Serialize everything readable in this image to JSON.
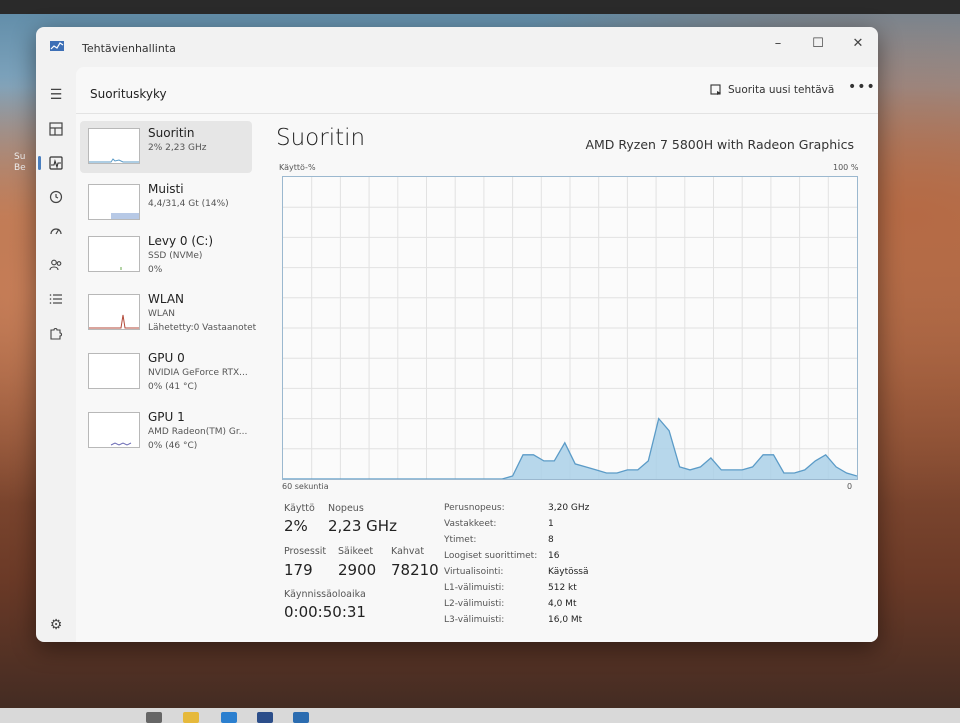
{
  "window": {
    "title": "Tehtävienhallinta"
  },
  "header": {
    "title": "Suorituskyky",
    "run_task": "Suorita uusi tehtävä",
    "more": "•••"
  },
  "desktop": {
    "label1": "Su",
    "label2": "Su",
    "label3": "Be"
  },
  "devices": [
    {
      "name": "Suoritin",
      "sub1": "2%  2,23 GHz",
      "sub2": "",
      "sub3": ""
    },
    {
      "name": "Muisti",
      "sub1": "4,4/31,4 Gt (14%)",
      "sub2": "",
      "sub3": ""
    },
    {
      "name": "Levy 0 (C:)",
      "sub1": "SSD (NVMe)",
      "sub2": "0%",
      "sub3": ""
    },
    {
      "name": "WLAN",
      "sub1": "WLAN",
      "sub2": "Lähetetty:0 Vastaanotet",
      "sub3": ""
    },
    {
      "name": "GPU 0",
      "sub1": "NVIDIA GeForce RTX...",
      "sub2": "0%  (41 °C)",
      "sub3": ""
    },
    {
      "name": "GPU 1",
      "sub1": "AMD Radeon(TM) Gr...",
      "sub2": "0%  (46 °C)",
      "sub3": ""
    }
  ],
  "cpu": {
    "title": "Suoritin",
    "model": "AMD Ryzen 7 5800H with Radeon Graphics",
    "graph_label": "Käyttö-%",
    "graph_max": "100 %",
    "time_span": "60 sekuntia",
    "time_end": "0"
  },
  "chart_data": {
    "type": "area",
    "title": "",
    "xlabel": "60 sekuntia",
    "ylabel": "Käyttö-%",
    "ylim": [
      0,
      100
    ],
    "x": [
      60,
      58,
      57,
      55,
      54,
      53,
      52,
      51,
      50,
      49,
      48,
      47,
      45,
      43,
      42,
      41,
      40,
      39,
      38,
      36,
      35,
      34,
      33,
      32,
      31,
      30,
      29,
      28,
      27,
      26,
      25,
      24,
      23,
      22,
      21,
      20,
      19,
      18,
      17,
      16,
      15,
      14,
      13,
      12,
      11,
      10,
      9,
      8,
      7,
      6,
      5,
      4,
      3,
      2,
      1,
      0
    ],
    "values": [
      0,
      0,
      0,
      0,
      0,
      0,
      0,
      0,
      0,
      0,
      0,
      0,
      0,
      0,
      0,
      0,
      0,
      0,
      0,
      0,
      0,
      0,
      0,
      0,
      0,
      0,
      0,
      0,
      0,
      0,
      0,
      0,
      0,
      0,
      0,
      0,
      0,
      0,
      0,
      0,
      0,
      0,
      0,
      0,
      0,
      0,
      0,
      0,
      0,
      0,
      0,
      0,
      0,
      0,
      0,
      0
    ],
    "series": [
      {
        "values": [
          0,
          0,
          0,
          0,
          0,
          0,
          0,
          0,
          0,
          0,
          0,
          0,
          0,
          0,
          0,
          0,
          0,
          0,
          0,
          0,
          0,
          0,
          1,
          8,
          8,
          6,
          6,
          12,
          5,
          4,
          3,
          2,
          2,
          3,
          3,
          6,
          20,
          16,
          4,
          3,
          4,
          7,
          3,
          3,
          3,
          4,
          8,
          8,
          2,
          2,
          3,
          6,
          8,
          4,
          2,
          1
        ]
      }
    ]
  },
  "stats": {
    "usage_label": "Käyttö",
    "usage_value": "2%",
    "speed_label": "Nopeus",
    "speed_value": "2,23 GHz",
    "processes_label": "Prosessit",
    "processes_value": "179",
    "threads_label": "Säikeet",
    "threads_value": "2900",
    "handles_label": "Kahvat",
    "handles_value": "78210",
    "uptime_label": "Käynnissäoloaika",
    "uptime_value": "0:00:50:31"
  },
  "info": [
    {
      "label": "Perusnopeus:",
      "value": "3,20 GHz"
    },
    {
      "label": "Vastakkeet:",
      "value": "1"
    },
    {
      "label": "Ytimet:",
      "value": "8"
    },
    {
      "label": "Loogiset suorittimet:",
      "value": "16"
    },
    {
      "label": "Virtualisointi:",
      "value": "Käytössä"
    },
    {
      "label": "L1-välimuisti:",
      "value": "512 kt"
    },
    {
      "label": "L2-välimuisti:",
      "value": "4,0 Mt"
    },
    {
      "label": "L3-välimuisti:",
      "value": "16,0 Mt"
    }
  ],
  "colors": {
    "graph_line": "#5b9bc7",
    "graph_fill": "#aad0e8",
    "grid": "#e2e2e2",
    "accent": "#4a7fbf"
  }
}
